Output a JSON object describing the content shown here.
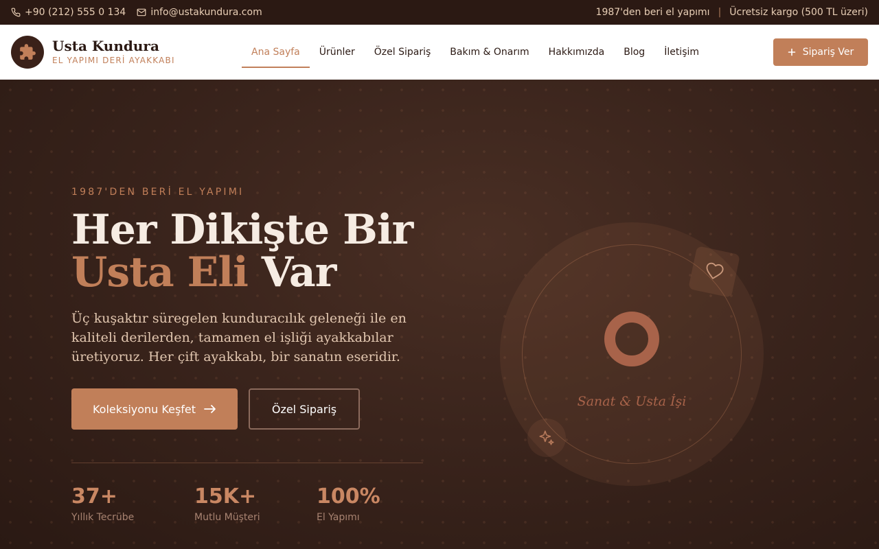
{
  "topbar": {
    "phone": "+90 (212) 555 0 134",
    "email": "info@ustakundura.com",
    "since_text": "1987'den beri el yapımı",
    "separator": "|",
    "shipping_text": "Ücretsiz kargo (500 TL üzeri)"
  },
  "brand": {
    "name": "Usta Kundura",
    "tagline": "EL YAPIMI DERİ AYAKKABI"
  },
  "nav": {
    "items": [
      {
        "label": "Ana Sayfa",
        "active": true
      },
      {
        "label": "Ürünler"
      },
      {
        "label": "Özel Sipariş"
      },
      {
        "label": "Bakım & Onarım"
      },
      {
        "label": "Hakkımızda"
      },
      {
        "label": "Blog"
      },
      {
        "label": "İletişim"
      }
    ],
    "cta_label": "Sipariş Ver"
  },
  "hero": {
    "eyebrow": "1987'DEN BERİ EL YAPIMI",
    "headline_line1": "Her Dikişte Bir",
    "headline_accent": "Usta Eli",
    "headline_rest": " Var",
    "lead": "Üç kuşaktır süregelen kunduracılık geleneği ile en kaliteli derilerden, tamamen el işliği ayakkabılar üretiyoruz. Her çift ayakkabı, bir sanatın eseridir.",
    "primary_button": "Koleksiyonu Keşfet",
    "secondary_button": "Özel Sipariş",
    "stats": [
      {
        "value": "37+",
        "label": "Yıllık Tecrübe"
      },
      {
        "value": "15K+",
        "label": "Mutlu Müşteri"
      },
      {
        "value": "100%",
        "label": "El Yapımı"
      }
    ],
    "visual_caption": "Sanat & Usta İşi"
  },
  "colors": {
    "accent": "#c17f59",
    "dark": "#2b1913",
    "white": "#ffffff"
  },
  "icons": [
    "phone-icon",
    "mail-icon",
    "puzzle-icon",
    "plus-icon",
    "arrow-right-icon",
    "heart-icon",
    "sparkle-icon"
  ]
}
